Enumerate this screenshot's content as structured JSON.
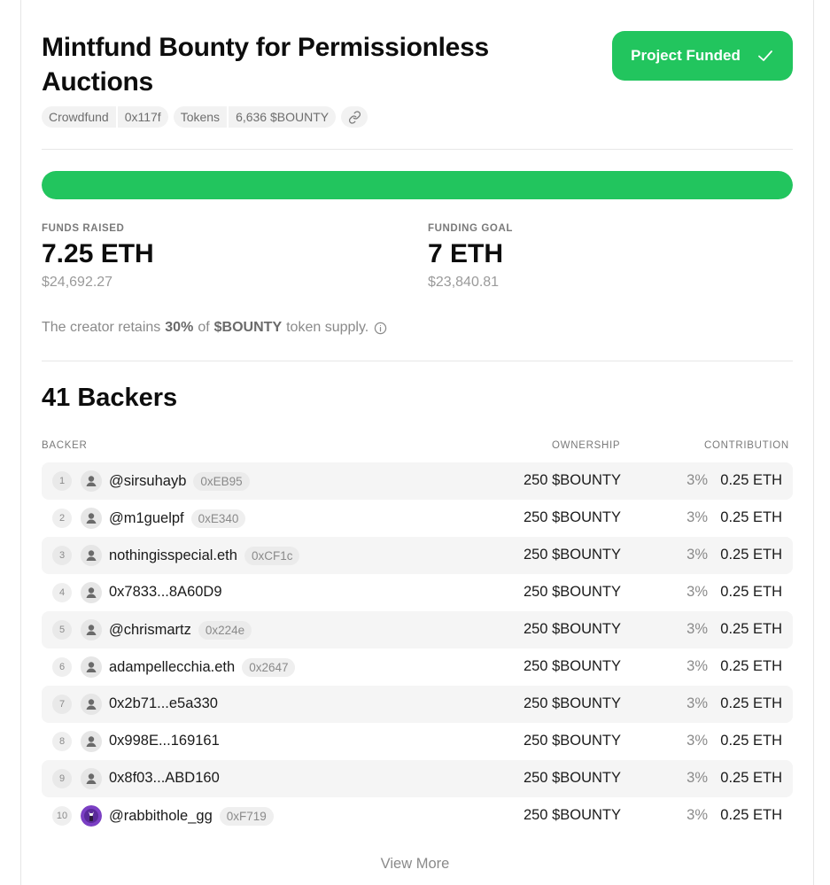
{
  "project": {
    "title": "Mintfund Bounty for Permissionless Auctions",
    "status_button": "Project Funded",
    "tags": {
      "type": "Crowdfund",
      "type_address": "0x117f",
      "tokens_label": "Tokens",
      "tokens_value": "6,636 $BOUNTY"
    }
  },
  "funding": {
    "progress_fraction": 1.0,
    "raised_label": "FUNDS RAISED",
    "raised_value": "7.25 ETH",
    "raised_usd": "$24,692.27",
    "goal_label": "FUNDING GOAL",
    "goal_value": "7 ETH",
    "goal_usd": "$23,840.81",
    "retain_prefix": "The creator retains",
    "retain_pct": "30%",
    "retain_of": "of",
    "retain_token": "$BOUNTY",
    "retain_suffix": "token supply."
  },
  "backers": {
    "title": "41 Backers",
    "columns": {
      "backer": "BACKER",
      "ownership": "OWNERSHIP",
      "contribution": "CONTRIBUTION"
    },
    "rows": [
      {
        "rank": "1",
        "name": "@sirsuhayb",
        "addr": "0xEB95",
        "ownership": "250 $BOUNTY",
        "pct": "3%",
        "contribution": "0.25 ETH"
      },
      {
        "rank": "2",
        "name": "@m1guelpf",
        "addr": "0xE340",
        "ownership": "250 $BOUNTY",
        "pct": "3%",
        "contribution": "0.25 ETH"
      },
      {
        "rank": "3",
        "name": "nothingisspecial.eth",
        "addr": "0xCF1c",
        "ownership": "250 $BOUNTY",
        "pct": "3%",
        "contribution": "0.25 ETH"
      },
      {
        "rank": "4",
        "name": "0x7833...8A60D9",
        "addr": "",
        "ownership": "250 $BOUNTY",
        "pct": "3%",
        "contribution": "0.25 ETH"
      },
      {
        "rank": "5",
        "name": "@chrismartz",
        "addr": "0x224e",
        "ownership": "250 $BOUNTY",
        "pct": "3%",
        "contribution": "0.25 ETH"
      },
      {
        "rank": "6",
        "name": "adampellecchia.eth",
        "addr": "0x2647",
        "ownership": "250 $BOUNTY",
        "pct": "3%",
        "contribution": "0.25 ETH"
      },
      {
        "rank": "7",
        "name": "0x2b71...e5a330",
        "addr": "",
        "ownership": "250 $BOUNTY",
        "pct": "3%",
        "contribution": "0.25 ETH"
      },
      {
        "rank": "8",
        "name": "0x998E...169161",
        "addr": "",
        "ownership": "250 $BOUNTY",
        "pct": "3%",
        "contribution": "0.25 ETH"
      },
      {
        "rank": "9",
        "name": "0x8f03...ABD160",
        "addr": "",
        "ownership": "250 $BOUNTY",
        "pct": "3%",
        "contribution": "0.25 ETH"
      },
      {
        "rank": "10",
        "name": "@rabbithole_gg",
        "addr": "0xF719",
        "ownership": "250 $BOUNTY",
        "pct": "3%",
        "contribution": "0.25 ETH",
        "custom_avatar": true
      }
    ],
    "view_more": "View More"
  },
  "colors": {
    "accent": "#22c55e",
    "muted_text": "#8a8a8a"
  }
}
